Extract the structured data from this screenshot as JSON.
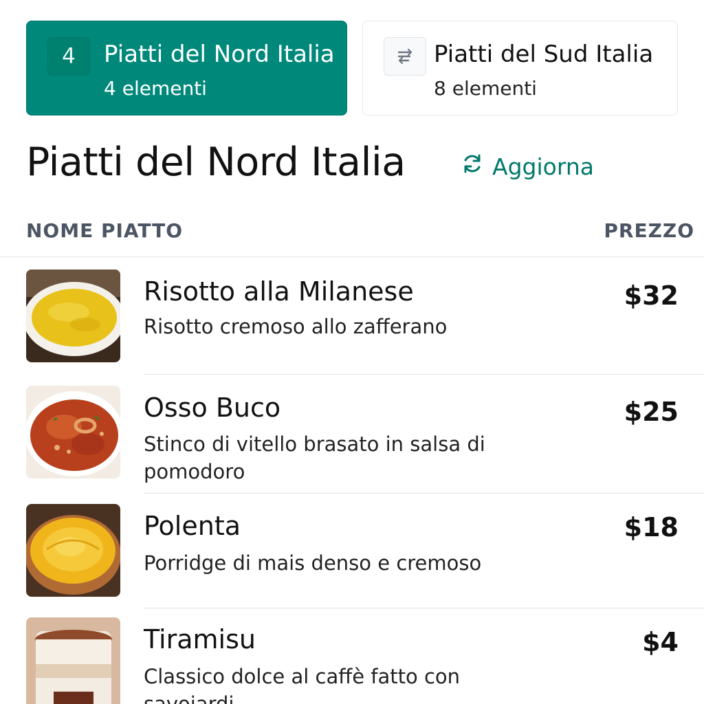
{
  "categories": [
    {
      "badge": "4",
      "title": "Piatti del Nord Italia",
      "count": "4 elementi",
      "active": true
    },
    {
      "badge_icon": "sort-icon",
      "title": "Piatti del Sud Italia",
      "count": "8 elementi",
      "active": false
    }
  ],
  "page_title": "Piatti del Nord Italia",
  "refresh_label": "Aggiorna",
  "table": {
    "col_name": "NOME PIATTO",
    "col_price": "PREZZO"
  },
  "dishes": [
    {
      "name": "Risotto alla Milanese",
      "description": "Risotto cremoso allo zafferano",
      "price": "$32",
      "image": "risotto-image"
    },
    {
      "name": "Osso Buco",
      "description": "Stinco di vitello brasato in salsa di pomodoro",
      "price": "$25",
      "image": "osso-buco-image"
    },
    {
      "name": "Polenta",
      "description": "Porridge di mais denso e cremoso",
      "price": "$18",
      "image": "polenta-image"
    },
    {
      "name": "Tiramisu",
      "description": "Classico dolce al caffè fatto con savoiardi",
      "price": "$4",
      "image": "tiramisu-image"
    }
  ],
  "colors": {
    "accent": "#00897b",
    "accent_text": "#00796b",
    "header_text": "#4b5563"
  }
}
